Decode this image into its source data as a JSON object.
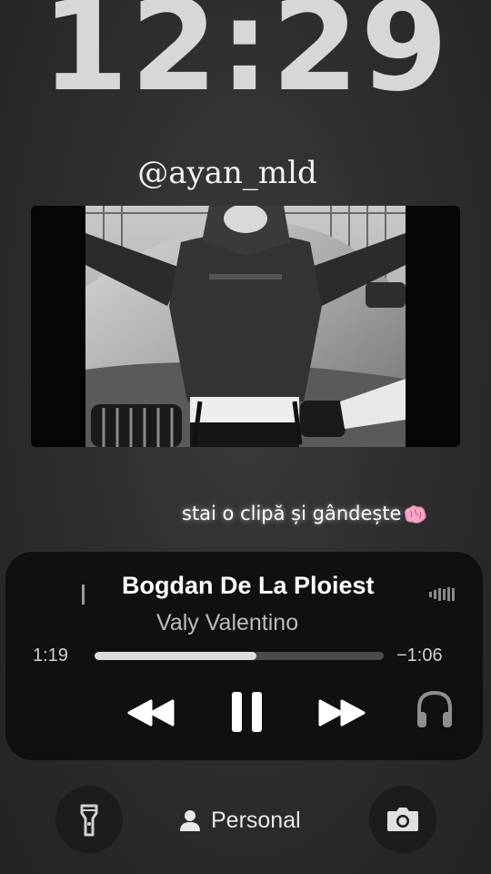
{
  "lock_screen": {
    "time": "12:29",
    "username": "@ayan_mld",
    "caption": "stai o clipă și gândește"
  },
  "now_playing": {
    "title": "Bogdan De La Ploiest",
    "artist": "Valy Valentino",
    "elapsed": "1:19",
    "remaining": "−1:06",
    "progress": 0.56
  },
  "controls": {
    "rewind_icon": "rewind-icon",
    "pause_icon": "pause-icon",
    "forward_icon": "fast-forward-icon",
    "output_icon": "headphones-icon"
  },
  "bottom_bar": {
    "focus_label": "Personal",
    "flashlight_icon": "flashlight-icon",
    "camera_icon": "camera-icon"
  },
  "colors": {
    "background": "#2c2c2c",
    "player_bg": "#0e0e0e",
    "text_primary": "#ffffff",
    "text_secondary": "#bdbdbd"
  }
}
